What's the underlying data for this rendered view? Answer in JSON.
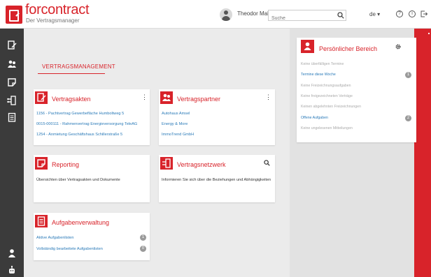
{
  "header": {
    "brand_pre": "for",
    "brand_post": "contract",
    "tagline": "Der Vertragsmanager",
    "user_name": "Theodor Malaki",
    "search_placeholder": "Suche",
    "language": "de ▾",
    "help_icon": "?",
    "info_icon": "i",
    "logout_icon": "logout-icon"
  },
  "sidebar": {
    "items": [
      {
        "name": "contracts-icon"
      },
      {
        "name": "partners-icon"
      },
      {
        "name": "reporting-icon"
      },
      {
        "name": "network-icon"
      },
      {
        "name": "tasks-icon"
      },
      {
        "name": "user-icon"
      },
      {
        "name": "robot-icon"
      }
    ]
  },
  "main": {
    "page_title": "VERTRAGSMANAGEMENT",
    "cards": {
      "vertragsakten": {
        "title": "Vertragsakten",
        "links": [
          "1156 - Pachtvertrag Gewerbefläche Humboltweg 5",
          "0015-000111 - Rahmenvertrag Energieversorgung TeleAG",
          "1254 - Anmietung Geschäftshaus Schillerstraße 5"
        ]
      },
      "vertragspartner": {
        "title": "Vertragspartner",
        "links": [
          "Autohaus Amsel",
          "Energy & More",
          "ImmoTrend GmbH"
        ]
      },
      "reporting": {
        "title": "Reporting",
        "text": "Übersichten über Vertragsakten und Dokumente"
      },
      "vertragsnetzwerk": {
        "title": "Vertragsnetzwerk",
        "text": "Informieren Sie sich über die Beziehungen und Abhängigkeiten"
      },
      "aufgabenverwaltung": {
        "title": "Aufgabenverwaltung",
        "rows": [
          {
            "label": "Aktive Aufgabenlisten",
            "count": "1"
          },
          {
            "label": "Vollständig bearbeitete Aufgabenlisten",
            "count": "0"
          }
        ]
      }
    }
  },
  "personal": {
    "title": "Persönlicher Bereich",
    "items": [
      {
        "label": "Keine überfälligen Termine",
        "count": ""
      },
      {
        "label": "Termine diese Woche",
        "count": "1"
      },
      {
        "label": "Keine Freizeichnungsaufgaben",
        "count": ""
      },
      {
        "label": "Keine freigezeichneten Verträge",
        "count": ""
      },
      {
        "label": "Keinen abgelehnten Freizeichnungen",
        "count": ""
      },
      {
        "label": "Offene Aufgaben",
        "count": "2"
      },
      {
        "label": "Keine ungelesenen Mitteilungen",
        "count": ""
      }
    ]
  },
  "colors": {
    "accent": "#d8232a",
    "link": "#2a7ab8",
    "sidebar": "#3b3b3b"
  }
}
